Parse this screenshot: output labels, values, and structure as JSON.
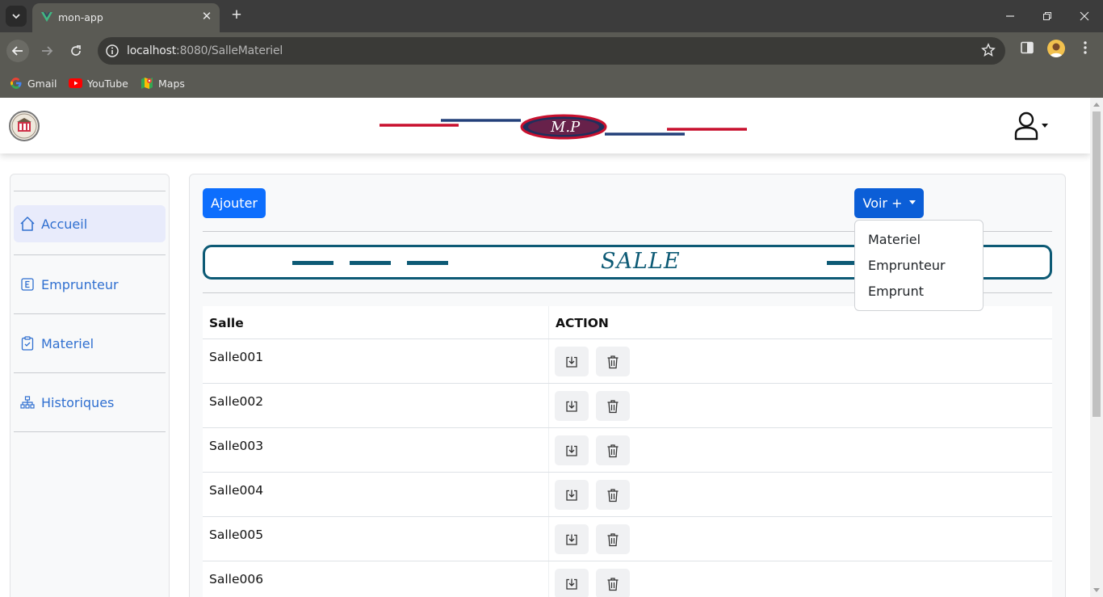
{
  "browser": {
    "tab_title": "mon-app",
    "url_host": "localhost",
    "url_rest": ":8080/SalleMateriel",
    "bookmarks": [
      "Gmail",
      "YouTube",
      "Maps"
    ]
  },
  "header": {
    "logo_text": "M.P"
  },
  "sidebar": {
    "items": [
      {
        "label": "Accueil",
        "icon": "home-icon",
        "active": true
      },
      {
        "label": "Emprunteur",
        "icon": "letter-e-icon",
        "active": false
      },
      {
        "label": "Materiel",
        "icon": "clipboard-icon",
        "active": false
      },
      {
        "label": "Historiques",
        "icon": "diagram-icon",
        "active": false
      }
    ]
  },
  "main": {
    "add_button": "Ajouter",
    "voir_button": "Voir +",
    "banner_title": "SALLE",
    "dropdown": [
      "Materiel",
      "Emprunteur",
      "Emprunt"
    ],
    "table": {
      "headers": [
        "Salle",
        "ACTION"
      ],
      "rows": [
        "Salle001",
        "Salle002",
        "Salle003",
        "Salle004",
        "Salle005",
        "Salle006"
      ]
    }
  },
  "colors": {
    "primary": "#0d6efd",
    "banner": "#0d5a75",
    "sidebar_link": "#2f6fd0",
    "logo_red": "#c8102e",
    "logo_navy": "#23407a"
  }
}
